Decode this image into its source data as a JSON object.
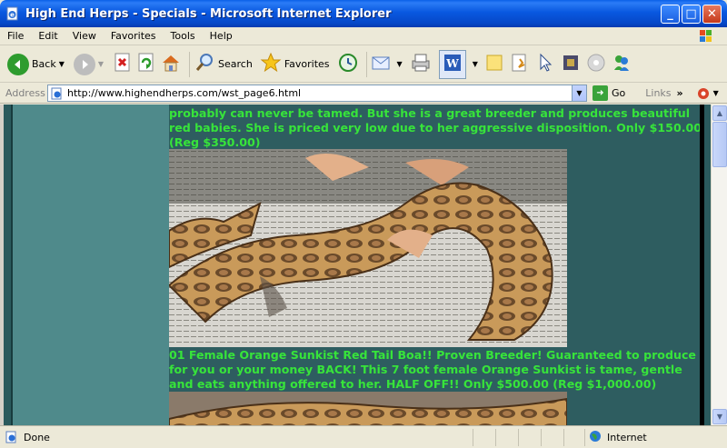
{
  "window": {
    "title": "High End Herps - Specials - Microsoft Internet Explorer",
    "minimize": "_",
    "maximize": "□",
    "close": "✕"
  },
  "menu": {
    "items": [
      "File",
      "Edit",
      "View",
      "Favorites",
      "Tools",
      "Help"
    ]
  },
  "toolbar": {
    "back_label": "Back",
    "search_label": "Search",
    "favorites_label": "Favorites"
  },
  "address": {
    "label": "Address",
    "url": "http://www.highendherps.com/wst_page6.html",
    "go_label": "Go",
    "links_label": "Links",
    "links_chevron": "»"
  },
  "content": {
    "paragraph_1": "probably can never be tamed. But she is a great breeder and produces beautiful red babies. She is priced very low due to her aggressive disposition. Only $150.00 (Reg $350.00)",
    "paragraph_2": "01 Female Orange Sunkist Red Tail Boa!! Proven Breeder! Guaranteed to produce for you or your money BACK! This 7 foot female Orange Sunkist is tame, gentle and eats anything offered to her. HALF OFF!! Only $500.00 (Reg $1,000.00)"
  },
  "status": {
    "text": "Done",
    "zone": "Internet"
  },
  "colors": {
    "page_bg": "#2e5d60",
    "sidebar_bg": "#4f8a8b",
    "text_green": "#37e43a"
  }
}
